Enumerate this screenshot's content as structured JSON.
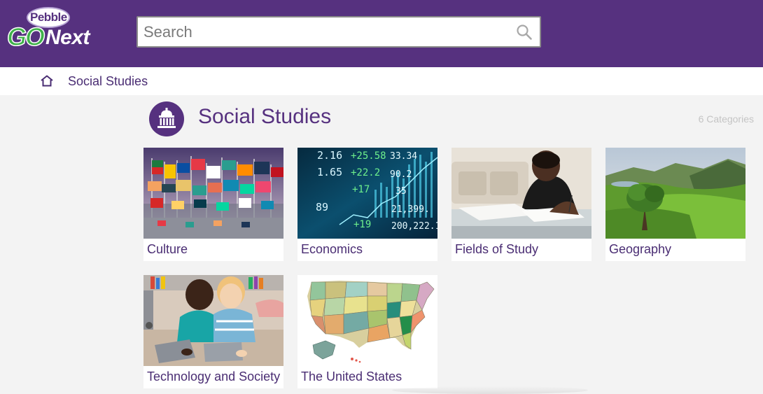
{
  "brand": {
    "logo_top": "Pebble",
    "logo_left": "GO",
    "logo_right": "Next"
  },
  "search": {
    "placeholder": "Search",
    "value": "",
    "icon": "magnifier-icon"
  },
  "breadcrumb": {
    "home_icon": "home-icon",
    "items": [
      "Social Studies"
    ]
  },
  "section": {
    "icon": "capitol-building-icon",
    "title": "Social Studies",
    "count_label": "6 Categories"
  },
  "categories": [
    {
      "label": "Culture",
      "image": "flags-photo"
    },
    {
      "label": "Economics",
      "image": "stock-ticker-photo"
    },
    {
      "label": "Fields of Study",
      "image": "student-studying-photo"
    },
    {
      "label": "Geography",
      "image": "green-landscape-photo"
    },
    {
      "label": "Technology and Society",
      "image": "kids-with-tablets-photo"
    },
    {
      "label": "The United States",
      "image": "us-map-photo"
    }
  ],
  "colors": {
    "brand_purple": "#56317f",
    "link_purple": "#4a2d73",
    "background": "#f3f3f3",
    "logo_green": "#3fb24a"
  }
}
